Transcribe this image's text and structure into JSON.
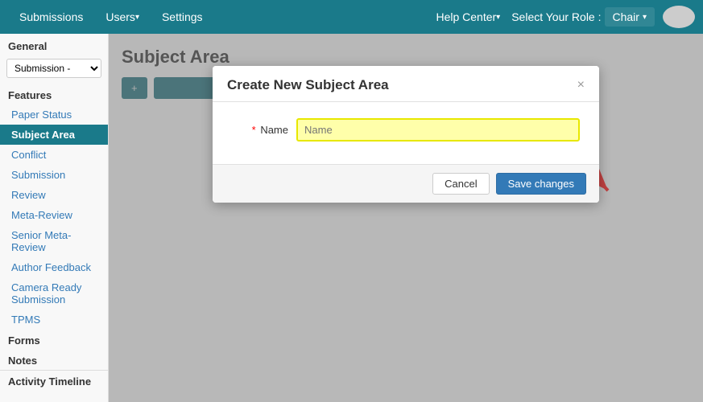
{
  "navbar": {
    "brand": "",
    "items": [
      "Submissions",
      "Users",
      "Settings"
    ],
    "users_dropdown": "Users",
    "help_center": "Help Center",
    "select_role_label": "Select Your Role :",
    "chair_label": "Chair"
  },
  "sidebar": {
    "general_title": "General",
    "submission_dropdown": "Submission -",
    "features_title": "Features",
    "items": [
      {
        "label": "Paper Status",
        "active": false
      },
      {
        "label": "Subject Area",
        "active": true
      },
      {
        "label": "Conflict",
        "active": false
      },
      {
        "label": "Submission",
        "active": false
      },
      {
        "label": "Review",
        "active": false
      },
      {
        "label": "Meta-Review",
        "active": false
      },
      {
        "label": "Senior Meta-Review",
        "active": false
      },
      {
        "label": "Author Feedback",
        "active": false
      },
      {
        "label": "Camera Ready Submission",
        "active": false
      },
      {
        "label": "TPMS",
        "active": false
      }
    ],
    "forms_title": "Forms",
    "notes_title": "Notes",
    "activity_title": "Activity Timeline"
  },
  "main": {
    "page_title": "Subject Area",
    "add_button": "+ ",
    "search_placeholder": ""
  },
  "modal": {
    "title": "Create New Subject Area",
    "close": "×",
    "name_label": "Name",
    "name_placeholder": "Name",
    "cancel_button": "Cancel",
    "save_button": "Save changes"
  }
}
